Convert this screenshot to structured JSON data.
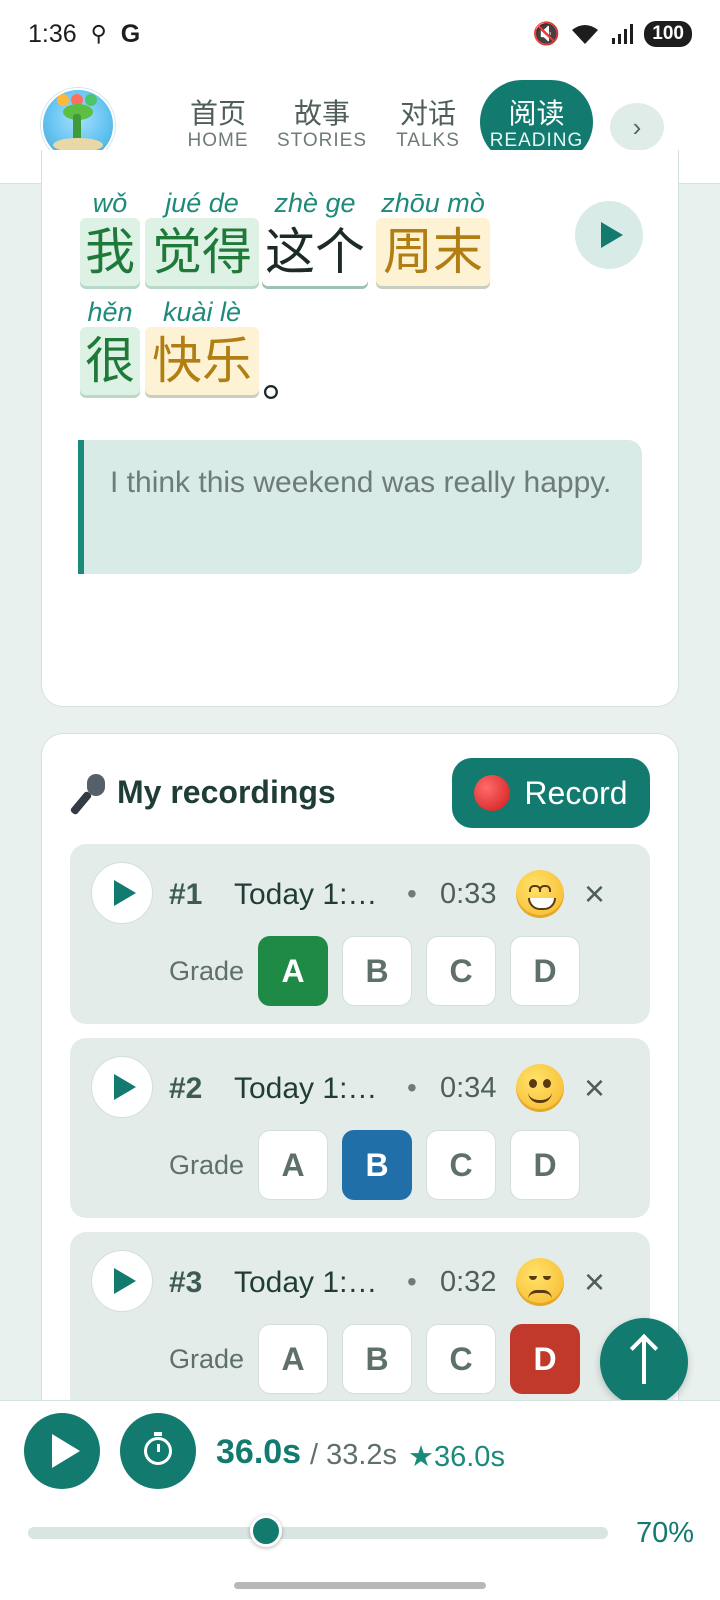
{
  "status_bar": {
    "time": "1:36",
    "google_label": "G",
    "battery": "100"
  },
  "nav": {
    "tabs": [
      {
        "zh": "首页",
        "en": "HOME"
      },
      {
        "zh": "故事",
        "en": "STORIES"
      },
      {
        "zh": "对话",
        "en": "TALKS"
      },
      {
        "zh": "阅读",
        "en": "READING"
      }
    ],
    "more_label": "›",
    "active_index": 3
  },
  "reading": {
    "words": [
      {
        "pinyin": "wǒ",
        "hanzi": "我",
        "style": "green"
      },
      {
        "pinyin": "jué de",
        "hanzi": "觉得",
        "style": "green"
      },
      {
        "pinyin": "zhè ge",
        "hanzi": "这个",
        "style": "plain"
      },
      {
        "pinyin": "zhōu mò",
        "hanzi": "周末",
        "style": "yellow"
      },
      {
        "pinyin": "hěn",
        "hanzi": "很",
        "style": "green"
      },
      {
        "pinyin": "kuài lè",
        "hanzi": "快乐",
        "style": "yellow"
      }
    ],
    "punctuation": "。",
    "translation": "I think this weekend was really happy."
  },
  "recordings": {
    "title": "My recordings",
    "record_label": "Record",
    "grade_label": "Grade",
    "grade_options": [
      "A",
      "B",
      "C",
      "D"
    ],
    "items": [
      {
        "number": "#1",
        "date": "Today 1:…",
        "separator": "•",
        "duration": "0:33",
        "emoji": "grinning-face-icon",
        "grade": "A"
      },
      {
        "number": "#2",
        "date": "Today 1:…",
        "separator": "•",
        "duration": "0:34",
        "emoji": "slightly-smiling-face-icon",
        "grade": "B"
      },
      {
        "number": "#3",
        "date": "Today 1:…",
        "separator": "•",
        "duration": "0:32",
        "emoji": "disappointed-face-icon",
        "grade": "D"
      }
    ],
    "close_label": "×"
  },
  "player": {
    "current_time": "36.0s",
    "total_time": "/ 33.2s",
    "best_time": "★36.0s",
    "speed": "70%",
    "speed_fraction": 0.41
  },
  "colors": {
    "accent": "#127a6e",
    "grade_a": "#1f8a45",
    "grade_b": "#216fa8",
    "grade_d": "#c0392b"
  }
}
